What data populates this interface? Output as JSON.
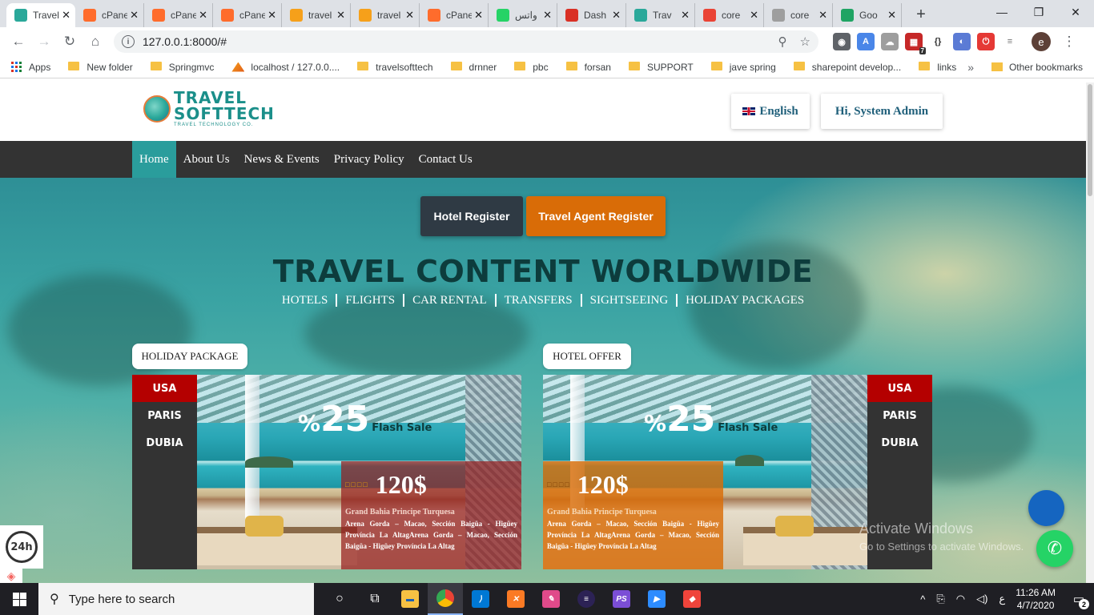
{
  "browser": {
    "tabs": [
      {
        "title": "Travel",
        "icon": "travelsofttech-favicon",
        "color": "#2aa89a",
        "active": true
      },
      {
        "title": "cPanel",
        "icon": "cpanel-icon",
        "color": "#ff6c2c"
      },
      {
        "title": "cPanel",
        "icon": "cpanel-icon",
        "color": "#ff6c2c"
      },
      {
        "title": "cPanel",
        "icon": "cpanel-icon",
        "color": "#ff6c2c"
      },
      {
        "title": "travel",
        "icon": "phpmyadmin-icon",
        "color": "#f6a01a"
      },
      {
        "title": "travel",
        "icon": "phpmyadmin-icon",
        "color": "#f6a01a"
      },
      {
        "title": "cPanel",
        "icon": "cpanel-icon",
        "color": "#ff6c2c"
      },
      {
        "title": "واتس",
        "icon": "whatsapp-icon",
        "color": "#25d366"
      },
      {
        "title": "Dash",
        "icon": "map-pin-icon",
        "color": "#d93025"
      },
      {
        "title": "Trav",
        "icon": "travelsofttech-favicon",
        "color": "#2aa89a"
      },
      {
        "title": "core",
        "icon": "gmail-icon",
        "color": "#ea4335"
      },
      {
        "title": "core",
        "icon": "shield-icon",
        "color": "#9e9e9e"
      },
      {
        "title": "Goo",
        "icon": "google-drive-icon",
        "color": "#1fa463"
      }
    ],
    "url": "127.0.0.1:8000/#",
    "bookmarks": [
      {
        "label": "Apps",
        "type": "apps"
      },
      {
        "label": "New folder",
        "type": "folder"
      },
      {
        "label": "Springmvc",
        "type": "folder"
      },
      {
        "label": "localhost / 127.0.0....",
        "type": "pma"
      },
      {
        "label": "travelsofttech",
        "type": "folder"
      },
      {
        "label": "drnner",
        "type": "folder"
      },
      {
        "label": "pbc",
        "type": "folder"
      },
      {
        "label": "forsan",
        "type": "folder"
      },
      {
        "label": "SUPPORT",
        "type": "folder"
      },
      {
        "label": "jave spring",
        "type": "folder"
      },
      {
        "label": "sharepoint develop...",
        "type": "folder"
      },
      {
        "label": "links",
        "type": "folder"
      }
    ],
    "bookmarks_more": "»",
    "other_bookmarks": "Other bookmarks",
    "profile_initial": "e",
    "extension_badge": "7"
  },
  "site": {
    "logo": {
      "line1": "TRAVEL",
      "line2": "SOFTTECH",
      "tagline": "TRAVEL TECHNOLOGY CO."
    },
    "language": "English",
    "user_greeting": "Hi, System Admin ",
    "nav": [
      "Home",
      "About Us",
      "News & Events",
      "Privacy Policy",
      "Contact Us"
    ],
    "hero": {
      "hotel_register": "Hotel Register",
      "agent_register": "Travel Agent Register",
      "title": "TRAVEL CONTENT WORLDWIDE",
      "services": [
        "HOTELS",
        "FLIGHTS",
        "CAR RENTAL",
        "TRANSFERS",
        "SIGHTSEEING",
        "HOLIDAY PACKAGES"
      ]
    },
    "cards": [
      {
        "label": "HOLIDAY PACKAGE",
        "destinations": [
          "USA",
          "PARIS",
          "DUBIA"
        ],
        "sale_pct": "%",
        "sale_num": "25",
        "sale_text": "Flash Sale",
        "stars": "□□□□",
        "price": "120$",
        "hotel_name": "Grand Bahia Principe  Turquesa",
        "address": "Arena Gorda – Macao, Sección Baigüa - Higüey Província La AltagArena Gorda – Macao, Sección Baigüa - Higüey Província La Altag"
      },
      {
        "label": "HOTEL OFFER",
        "destinations": [
          "USA",
          "PARIS",
          "DUBIA"
        ],
        "sale_pct": "%",
        "sale_num": "25",
        "sale_text": "Flash Sale",
        "stars": "□□□□",
        "price": "120$",
        "hotel_name": "Grand Bahia Principe  Turquesa",
        "address": "Arena Gorda – Macao, Sección Baigüa - Higüey Província La AltagArena Gorda – Macao, Sección Baigüa - Higüey Província La Altag"
      }
    ],
    "support_label": "24h",
    "chat_glyph": "",
    "whatsapp_glyph": "✆"
  },
  "os": {
    "watermark_line1": "Activate Windows",
    "watermark_line2": "Go to Settings to activate Windows.",
    "search_placeholder": "Type here to search",
    "time": "11:26 AM",
    "date": "4/7/2020",
    "input_lang": "ع",
    "notification_count": "2"
  }
}
